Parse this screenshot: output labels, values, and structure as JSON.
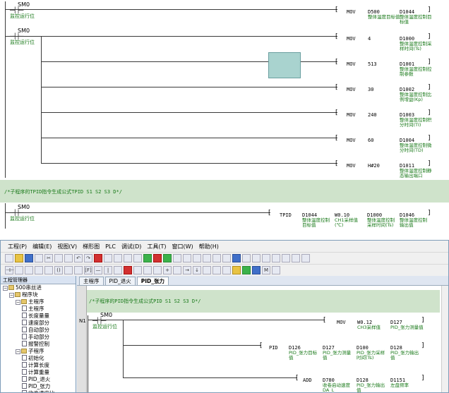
{
  "top_ladder": {
    "contacts": [
      {
        "id": "SM0",
        "label": "监控运行位"
      },
      {
        "id": "SM0",
        "label": "监控运行位"
      }
    ],
    "mov_rows": [
      {
        "op": "MOV",
        "src": "D500",
        "src_comment": "整体温度目标值",
        "dst": "D1044",
        "dst_comment": "整体温度控制目标值"
      },
      {
        "op": "MOV",
        "src": "4",
        "src_comment": "",
        "dst": "D1000",
        "dst_comment": "整体温度控制采样时间(Ts)"
      },
      {
        "op": "MOV",
        "src": "513",
        "src_comment": "",
        "dst": "D1001",
        "dst_comment": "整体温度控制控制参数"
      },
      {
        "op": "MOV",
        "src": "30",
        "src_comment": "",
        "dst": "D1002",
        "dst_comment": "整体温度控制比例增益(Kp)"
      },
      {
        "op": "MOV",
        "src": "240",
        "src_comment": "",
        "dst": "D1003",
        "dst_comment": "整体温度控制积分时间(TI)"
      },
      {
        "op": "MOV",
        "src": "60",
        "src_comment": "",
        "dst": "D1004",
        "dst_comment": "整体温度控制微分时间(TD)"
      },
      {
        "op": "MOV",
        "src": "H#20",
        "src_comment": "",
        "dst": "D1011",
        "dst_comment": "整体温度控制静态输出端口"
      }
    ],
    "comment_line": "/*子程序的TPID指令生成公式TPID S1 S2 S3 D*/",
    "tpid_row": {
      "contact_id": "SM0",
      "contact_label": "监控运行位",
      "op": "TPID",
      "operands": [
        {
          "v": "D1044",
          "c": "整体温度控制目标值"
        },
        {
          "v": "W0.10",
          "c": "CH1采样值(℃)"
        },
        {
          "v": "D1000",
          "c": "整体温度控制采样时间(Ts)"
        },
        {
          "v": "D1046",
          "c": "整体温度控制输出值"
        }
      ]
    }
  },
  "app": {
    "menu": [
      "工程(P)",
      "编辑(E)",
      "视图(V)",
      "梯形图",
      "PLC",
      "调试(D)",
      "工具(T)",
      "窗口(W)",
      "帮助(H)"
    ],
    "sidebar": {
      "title": "工程管理器",
      "tree": [
        {
          "level": 0,
          "type": "root",
          "label": "500串丝进"
        },
        {
          "level": 1,
          "type": "folder",
          "label": "程序块"
        },
        {
          "level": 2,
          "type": "folder",
          "label": "主程序"
        },
        {
          "level": 3,
          "type": "doc",
          "label": "主程序"
        },
        {
          "level": 3,
          "type": "doc",
          "label": "长度量量"
        },
        {
          "level": 3,
          "type": "doc",
          "label": "速度部分"
        },
        {
          "level": 3,
          "type": "doc",
          "label": "自动部分"
        },
        {
          "level": 3,
          "type": "doc",
          "label": "手动部分"
        },
        {
          "level": 3,
          "type": "doc",
          "label": "报警控制"
        },
        {
          "level": 2,
          "type": "folder",
          "label": "子程序"
        },
        {
          "level": 3,
          "type": "doc",
          "label": "初始化"
        },
        {
          "level": 3,
          "type": "doc",
          "label": "计算长度"
        },
        {
          "level": 3,
          "type": "doc",
          "label": "计算重量"
        },
        {
          "level": 3,
          "type": "doc",
          "label": "PID_退火"
        },
        {
          "level": 3,
          "type": "doc",
          "label": "PID_张力"
        },
        {
          "level": 3,
          "type": "doc",
          "label": "收卷速度比"
        }
      ]
    },
    "tabs": [
      "主程序",
      "PID_退火",
      "PID_张力"
    ],
    "active_tab": "PID_张力",
    "editor": {
      "comment": "/*子程序的PID指令生成公式PID S1 S2 S3 D*/",
      "network": "N1",
      "contact_id": "SM0",
      "contact_label": "监控运行位",
      "rows": [
        {
          "op": "MOV",
          "operands": [
            {
              "v": "W0.12",
              "c": "CH3采样值"
            },
            {
              "v": "D127",
              "c": "PID_张力测量值"
            }
          ]
        },
        {
          "op": "PID",
          "operands": [
            {
              "v": "D126",
              "c": "PID_张力目标值"
            },
            {
              "v": "D127",
              "c": "PID_张力测量值"
            },
            {
              "v": "D100",
              "c": "PID_张力采样时间(Ts)"
            },
            {
              "v": "D128",
              "c": "PID_张力输出值"
            }
          ]
        },
        {
          "op": "ADD",
          "operands": [
            {
              "v": "D780",
              "c": "收卷启动速度DA_L"
            },
            {
              "v": "D128",
              "c": "PID_张力输出值"
            },
            {
              "v": "D1151",
              "c": "左盘频率"
            }
          ]
        }
      ]
    }
  }
}
